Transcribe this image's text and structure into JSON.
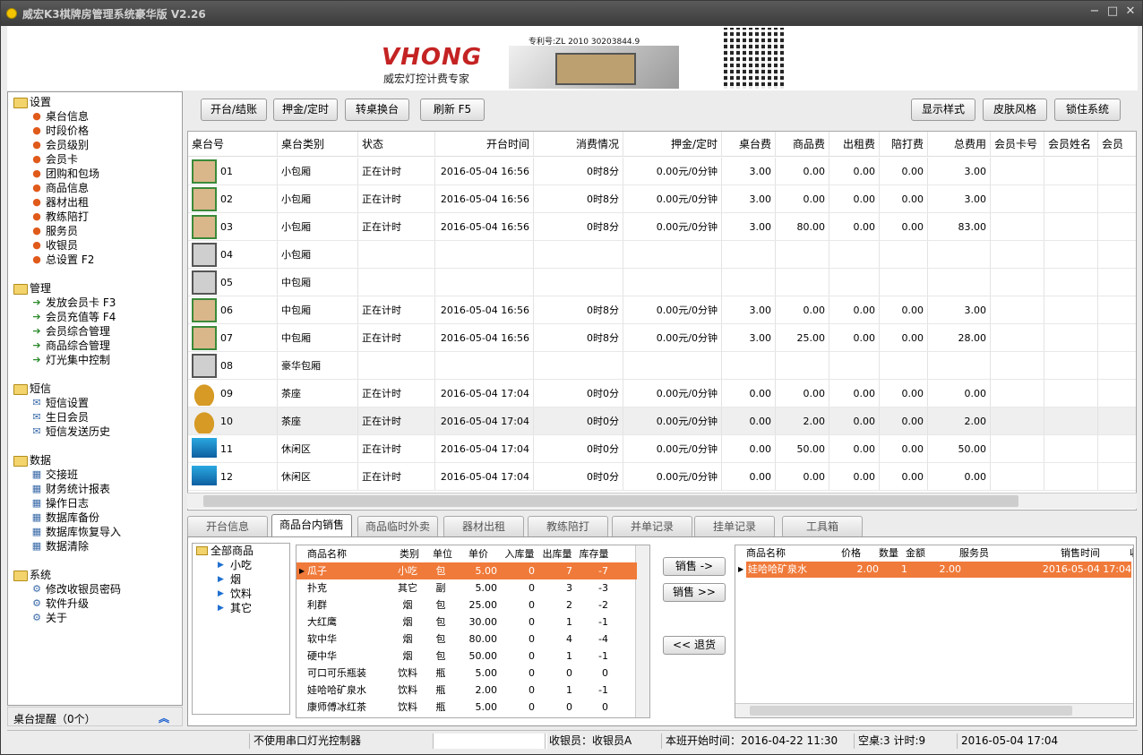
{
  "window": {
    "title": "威宏K3棋牌房管理系统豪华版 V2.26",
    "controls": [
      "−",
      "□",
      "✕"
    ]
  },
  "banner": {
    "logo": "VHONG",
    "slogan": "威宏灯控计费专家",
    "patent": "专利号:ZL 2010 30203844.9"
  },
  "sidebar": {
    "groups": [
      {
        "title": "设置",
        "items": [
          "桌台信息",
          "时段价格",
          "会员级别",
          "会员卡",
          "团购和包场",
          "商品信息",
          "器材出租",
          "教练陪打",
          "服务员",
          "收银员",
          "总设置 F2"
        ]
      },
      {
        "title": "管理",
        "items": [
          "发放会员卡 F3",
          "会员充值等 F4",
          "会员综合管理",
          "商品综合管理",
          "灯光集中控制"
        ]
      },
      {
        "title": "短信",
        "items": [
          "短信设置",
          "生日会员",
          "短信发送历史"
        ]
      },
      {
        "title": "数据",
        "items": [
          "交接班",
          "财务统计报表",
          "操作日志",
          "数据库备份",
          "数据库恢复导入",
          "数据清除"
        ]
      },
      {
        "title": "系统",
        "items": [
          "修改收银员密码",
          "软件升级",
          "关于"
        ]
      }
    ],
    "reminder": "桌台提醒（0个）"
  },
  "toolbar": {
    "open_close": "开台/结账",
    "deposit": "押金/定时",
    "transfer": "转桌换台",
    "refresh": "刷新 F5",
    "display": "显示样式",
    "skin": "皮肤风格",
    "lock": "锁住系统"
  },
  "grid": {
    "columns": [
      "桌台号",
      "桌台类别",
      "状态",
      "开台时间",
      "消费情况",
      "押金/定时",
      "桌台费",
      "商品费",
      "出租费",
      "陪打费",
      "总费用",
      "会员卡号",
      "会员姓名",
      "会员"
    ],
    "rows": [
      {
        "icon": "table-on",
        "no": "01",
        "type": "小包厢",
        "status": "正在计时",
        "start": "2016-05-04 16:56",
        "usage": "0时8分",
        "deposit": "0.00元/0分钟",
        "tablefee": "3.00",
        "goods": "0.00",
        "rent": "0.00",
        "coach": "0.00",
        "total": "3.00"
      },
      {
        "icon": "table-on",
        "no": "02",
        "type": "小包厢",
        "status": "正在计时",
        "start": "2016-05-04 16:56",
        "usage": "0时8分",
        "deposit": "0.00元/0分钟",
        "tablefee": "3.00",
        "goods": "0.00",
        "rent": "0.00",
        "coach": "0.00",
        "total": "3.00"
      },
      {
        "icon": "table-on",
        "no": "03",
        "type": "小包厢",
        "status": "正在计时",
        "start": "2016-05-04 16:56",
        "usage": "0时8分",
        "deposit": "0.00元/0分钟",
        "tablefee": "3.00",
        "goods": "80.00",
        "rent": "0.00",
        "coach": "0.00",
        "total": "83.00"
      },
      {
        "icon": "table-off",
        "no": "04",
        "type": "小包厢",
        "status": "",
        "start": "",
        "usage": "",
        "deposit": "",
        "tablefee": "",
        "goods": "",
        "rent": "",
        "coach": "",
        "total": ""
      },
      {
        "icon": "table-off",
        "no": "05",
        "type": "中包厢",
        "status": "",
        "start": "",
        "usage": "",
        "deposit": "",
        "tablefee": "",
        "goods": "",
        "rent": "",
        "coach": "",
        "total": ""
      },
      {
        "icon": "table-on",
        "no": "06",
        "type": "中包厢",
        "status": "正在计时",
        "start": "2016-05-04 16:56",
        "usage": "0时8分",
        "deposit": "0.00元/0分钟",
        "tablefee": "3.00",
        "goods": "0.00",
        "rent": "0.00",
        "coach": "0.00",
        "total": "3.00"
      },
      {
        "icon": "table-on",
        "no": "07",
        "type": "中包厢",
        "status": "正在计时",
        "start": "2016-05-04 16:56",
        "usage": "0时8分",
        "deposit": "0.00元/0分钟",
        "tablefee": "3.00",
        "goods": "25.00",
        "rent": "0.00",
        "coach": "0.00",
        "total": "28.00"
      },
      {
        "icon": "table-off",
        "no": "08",
        "type": "豪华包厢",
        "status": "",
        "start": "",
        "usage": "",
        "deposit": "",
        "tablefee": "",
        "goods": "",
        "rent": "",
        "coach": "",
        "total": ""
      },
      {
        "icon": "teapot",
        "no": "09",
        "type": "茶座",
        "status": "正在计时",
        "start": "2016-05-04 17:04",
        "usage": "0时0分",
        "deposit": "0.00元/0分钟",
        "tablefee": "0.00",
        "goods": "0.00",
        "rent": "0.00",
        "coach": "0.00",
        "total": "0.00"
      },
      {
        "icon": "teapot",
        "no": "10",
        "type": "茶座",
        "status": "正在计时",
        "start": "2016-05-04 17:04",
        "usage": "0时0分",
        "deposit": "0.00元/0分钟",
        "tablefee": "0.00",
        "goods": "2.00",
        "rent": "0.00",
        "coach": "0.00",
        "total": "2.00"
      },
      {
        "icon": "monitor",
        "no": "11",
        "type": "休闲区",
        "status": "正在计时",
        "start": "2016-05-04 17:04",
        "usage": "0时0分",
        "deposit": "0.00元/0分钟",
        "tablefee": "0.00",
        "goods": "50.00",
        "rent": "0.00",
        "coach": "0.00",
        "total": "50.00"
      },
      {
        "icon": "monitor",
        "no": "12",
        "type": "休闲区",
        "status": "正在计时",
        "start": "2016-05-04 17:04",
        "usage": "0时0分",
        "deposit": "0.00元/0分钟",
        "tablefee": "0.00",
        "goods": "0.00",
        "rent": "0.00",
        "coach": "0.00",
        "total": "0.00"
      }
    ]
  },
  "tabs": [
    "开台信息",
    "商品台内销售",
    "商品临时外卖",
    "器材出租",
    "教练陪打",
    "并单记录",
    "挂单记录",
    "工具箱"
  ],
  "tree": {
    "root": "全部商品",
    "children": [
      "小吃",
      "烟",
      "饮料",
      "其它"
    ]
  },
  "products": {
    "columns": [
      "商品名称",
      "类别",
      "单位",
      "单价",
      "入库量",
      "出库量",
      "库存量"
    ],
    "rows": [
      [
        "瓜子",
        "小吃",
        "包",
        "5.00",
        "0",
        "7",
        "-7"
      ],
      [
        "扑克",
        "其它",
        "副",
        "5.00",
        "0",
        "3",
        "-3"
      ],
      [
        "利群",
        "烟",
        "包",
        "25.00",
        "0",
        "2",
        "-2"
      ],
      [
        "大红鹰",
        "烟",
        "包",
        "30.00",
        "0",
        "1",
        "-1"
      ],
      [
        "软中华",
        "烟",
        "包",
        "80.00",
        "0",
        "4",
        "-4"
      ],
      [
        "硬中华",
        "烟",
        "包",
        "50.00",
        "0",
        "1",
        "-1"
      ],
      [
        "可口可乐瓶装",
        "饮料",
        "瓶",
        "5.00",
        "0",
        "0",
        "0"
      ],
      [
        "娃哈哈矿泉水",
        "饮料",
        "瓶",
        "2.00",
        "0",
        "1",
        "-1"
      ],
      [
        "康师傅冰红茶",
        "饮料",
        "瓶",
        "5.00",
        "0",
        "0",
        "0"
      ]
    ]
  },
  "sale_buttons": {
    "sell_one": "销售 ->",
    "sell_many": "销售 >>",
    "return": "<< 退货"
  },
  "sold": {
    "columns": [
      "商品名称",
      "价格",
      "数量",
      "金额",
      "服务员",
      "销售时间",
      "收"
    ],
    "rows": [
      [
        "娃哈哈矿泉水",
        "2.00",
        "1",
        "2.00",
        "",
        "2016-05-04 17:04",
        "收"
      ]
    ]
  },
  "status": {
    "light": "不使用串口灯光控制器",
    "cashier": "收银员：收银员A",
    "shift": "本班开始时间：2016-04-22 11:30",
    "tables": "空桌:3 计时:9",
    "now": "2016-05-04 17:04"
  }
}
